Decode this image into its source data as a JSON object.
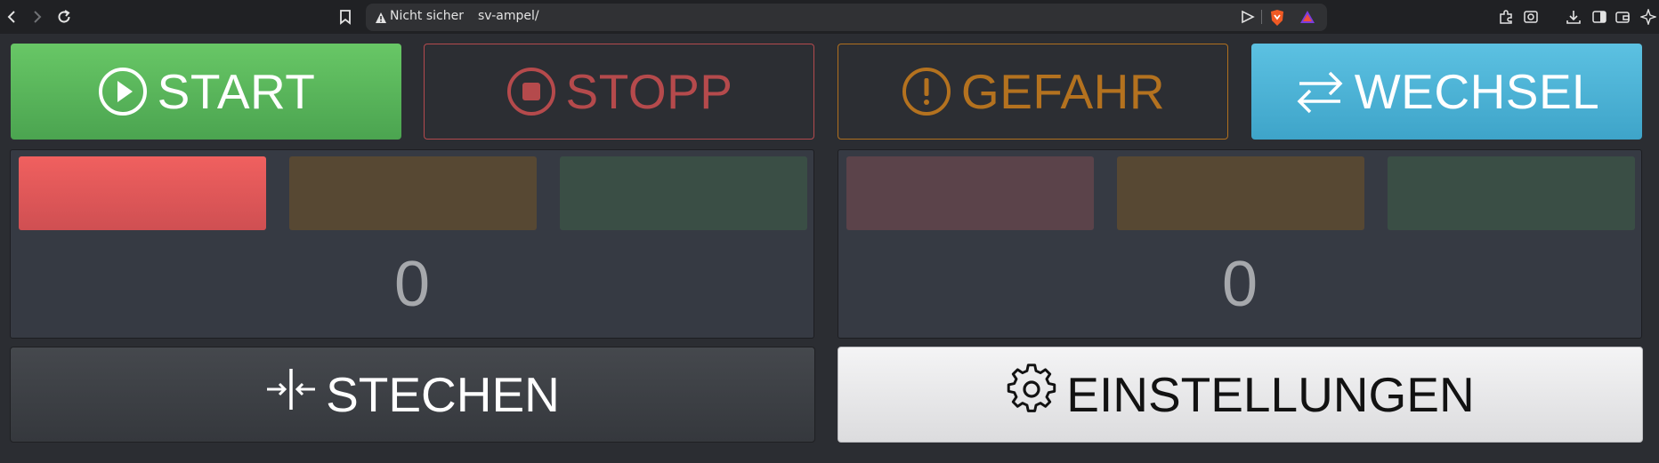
{
  "browser": {
    "security_label": "Nicht sicher",
    "url": "sv-ampel/",
    "icons": [
      "back-icon",
      "forward-icon",
      "reload-icon",
      "bookmark-icon",
      "warning-icon",
      "share-icon",
      "brave-shield-icon",
      "brave-rewards-icon",
      "extensions-icon",
      "screenshot-icon",
      "download-icon",
      "sidebar-icon",
      "wallet-icon",
      "leo-icon"
    ]
  },
  "controls": {
    "start": "START",
    "stopp": "STOPP",
    "gefahr": "GEFAHR",
    "wechsel": "WECHSEL"
  },
  "lights": {
    "left": {
      "score": "0",
      "lamps": [
        {
          "state": "on",
          "color": "#ec5c5f"
        },
        {
          "state": "off",
          "color": "#574833"
        },
        {
          "state": "off",
          "color": "#3a4e45"
        }
      ]
    },
    "right": {
      "score": "0",
      "lamps": [
        {
          "state": "off",
          "color": "#5b434a"
        },
        {
          "state": "off",
          "color": "#574833"
        },
        {
          "state": "off",
          "color": "#3a4e45"
        }
      ]
    }
  },
  "bottom": {
    "stechen": "STECHEN",
    "einstellungen": "EINSTELLUNGEN"
  },
  "colors": {
    "start": "#5cb85c",
    "stopp": "#b54a4c",
    "gefahr": "#b4721f",
    "wechsel": "#4bb1d6"
  }
}
